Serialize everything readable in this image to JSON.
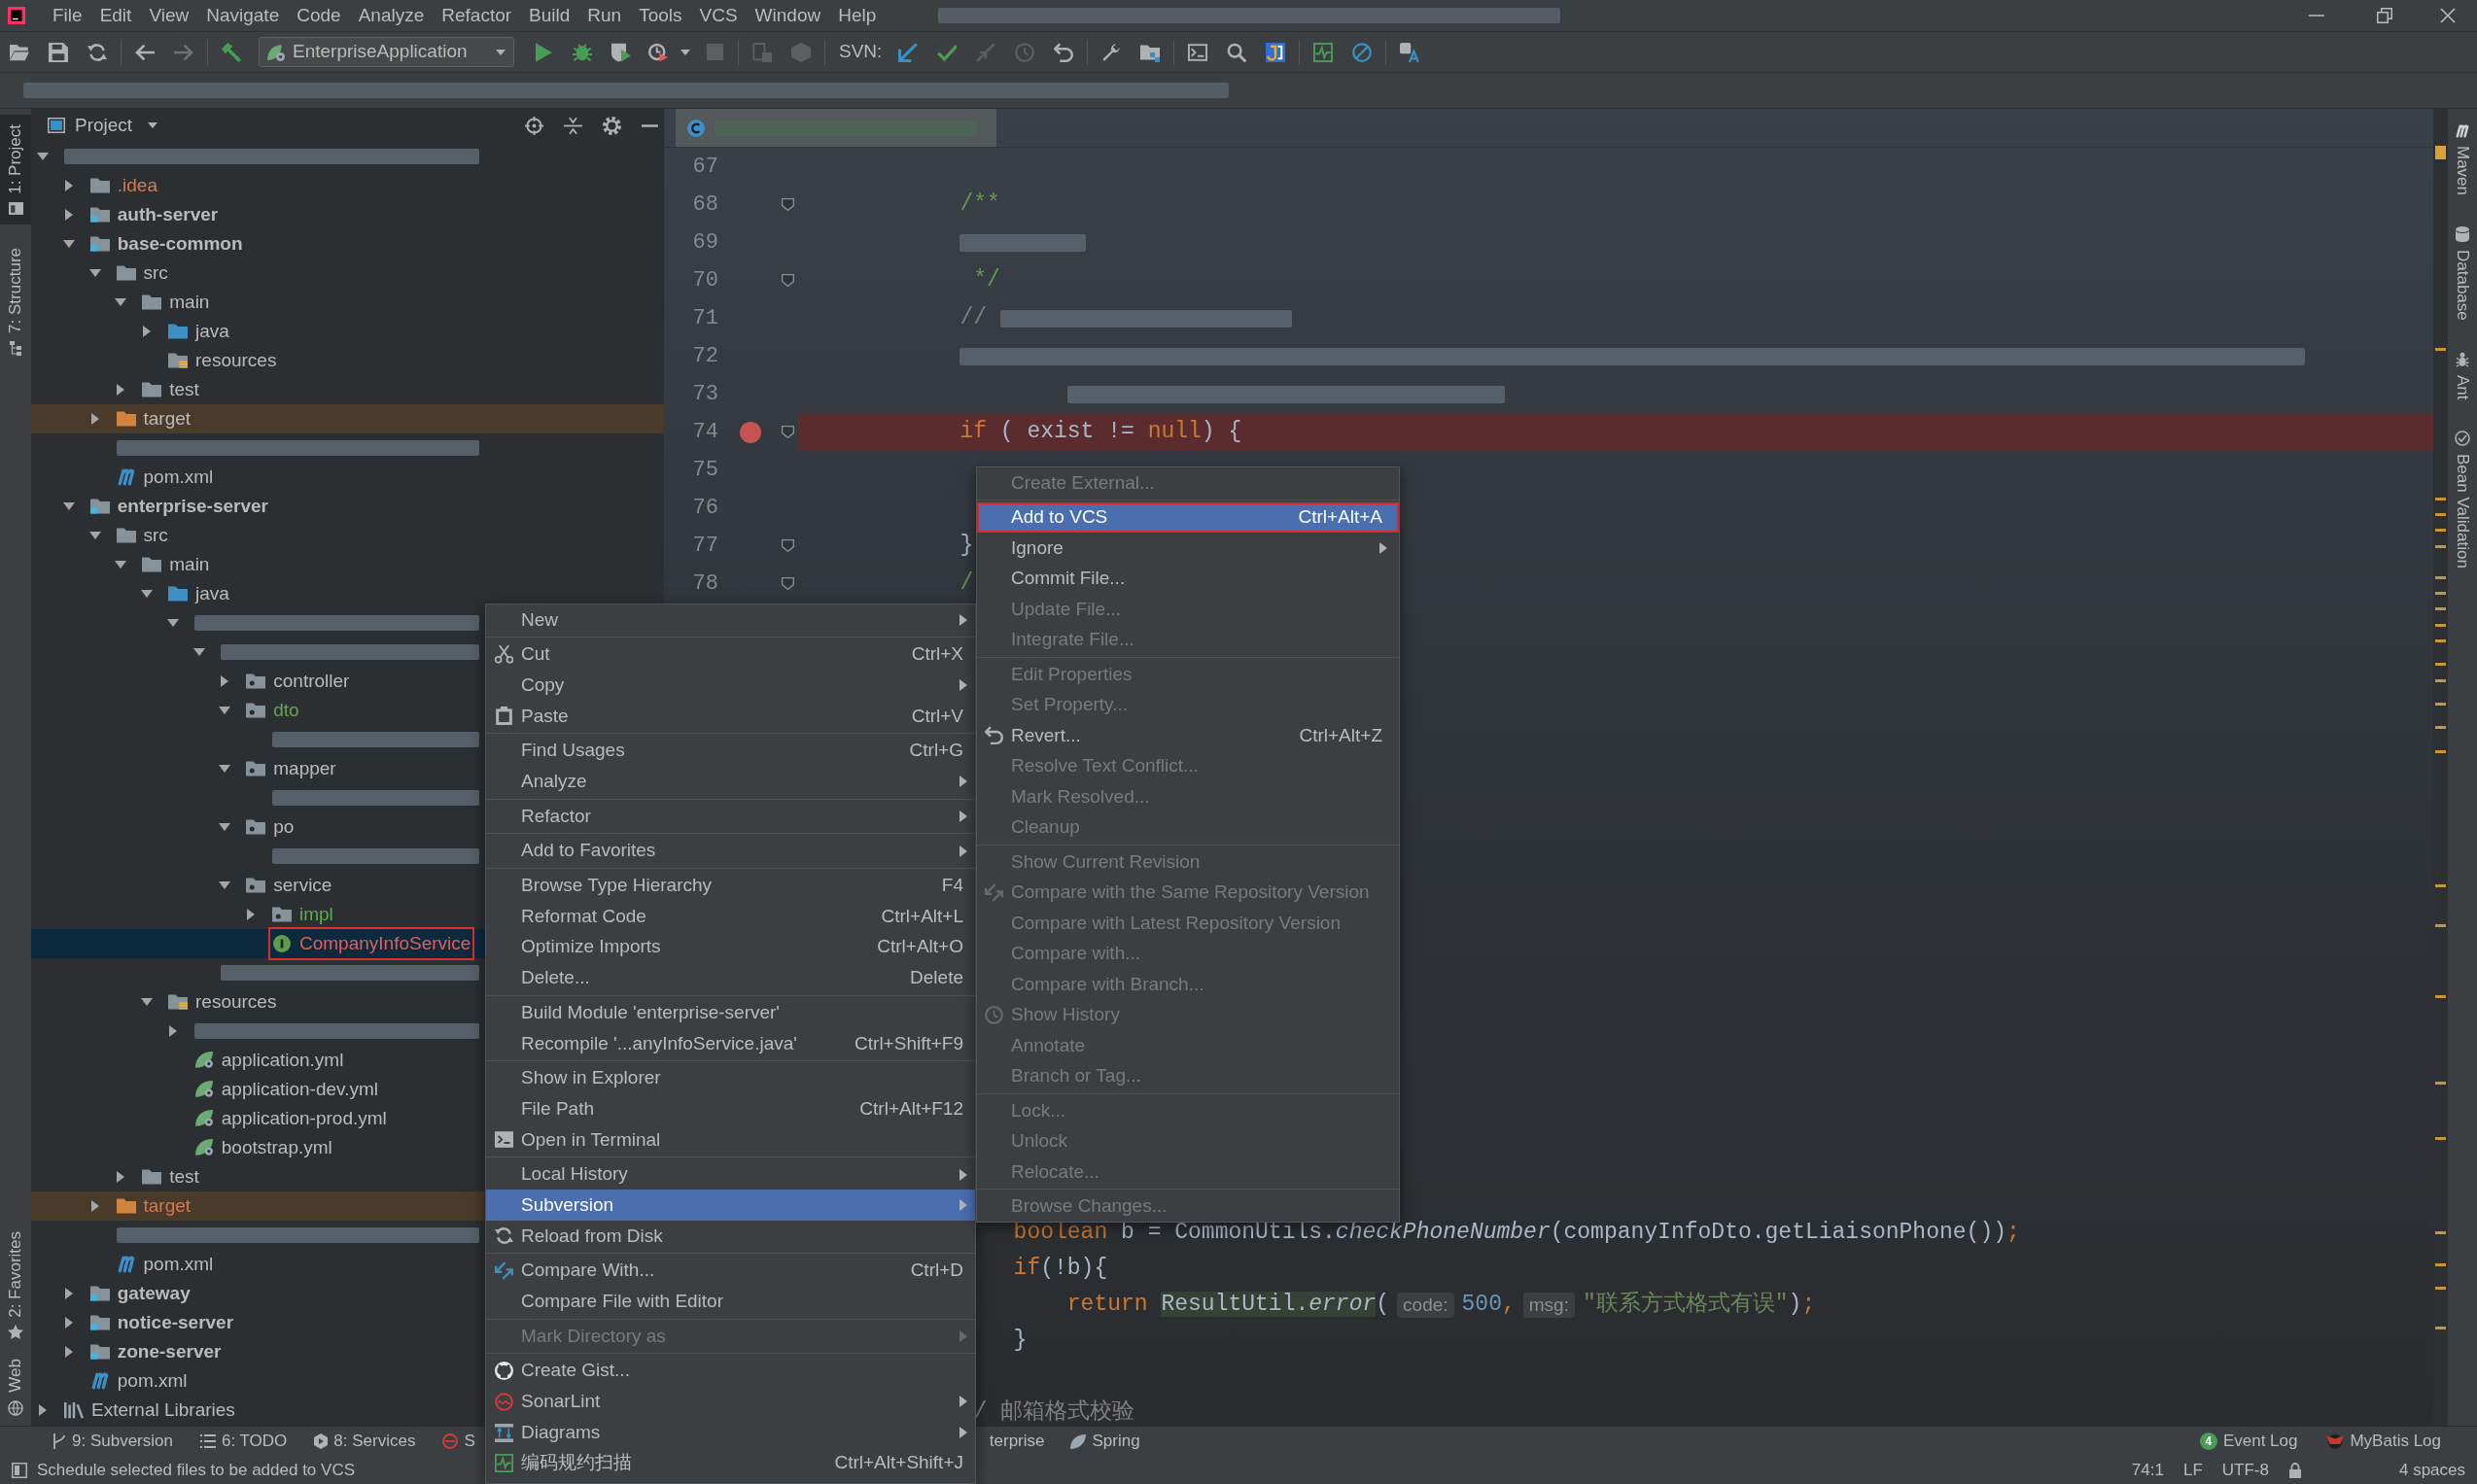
{
  "window_title": {
    "kind": "redacted"
  },
  "menu_bar": {
    "items": [
      "File",
      "Edit",
      "View",
      "Navigate",
      "Code",
      "Analyze",
      "Refactor",
      "Build",
      "Run",
      "Tools",
      "VCS",
      "Window",
      "Help"
    ]
  },
  "toolbar": {
    "run_configuration": "EnterpriseApplication",
    "svn_label": "SVN:"
  },
  "navigation_bar": {
    "kind": "redacted"
  },
  "left_strip": {
    "tabs": [
      {
        "label": "1: Project",
        "selected": true
      },
      {
        "label": "7: Structure",
        "selected": false
      },
      {
        "label": "2: Favorites",
        "selected": false
      },
      {
        "label": "Web",
        "selected": false
      }
    ]
  },
  "project_panel": {
    "title": "Project",
    "tree": [
      {
        "kind": "redacted",
        "expanded": true,
        "selected": false,
        "outlined": false,
        "children": [
          {
            "label": ".idea",
            "kind": "folder",
            "ignored": true,
            "added": false,
            "unversioned": false,
            "expanded": false,
            "selected": false,
            "outlined": false
          },
          {
            "label": "auth-server",
            "kind": "module",
            "ignored": false,
            "added": false,
            "unversioned": false,
            "expanded": false,
            "selected": false,
            "outlined": false
          },
          {
            "label": "base-common",
            "kind": "module",
            "ignored": false,
            "added": false,
            "unversioned": false,
            "expanded": true,
            "selected": false,
            "outlined": false,
            "children": [
              {
                "label": "src",
                "kind": "folder",
                "ignored": false,
                "added": false,
                "unversioned": false,
                "expanded": true,
                "selected": false,
                "outlined": false,
                "children": [
                  {
                    "label": "main",
                    "kind": "folder",
                    "ignored": false,
                    "added": false,
                    "unversioned": false,
                    "expanded": true,
                    "selected": false,
                    "outlined": false,
                    "children": [
                      {
                        "label": "java",
                        "kind": "source",
                        "ignored": false,
                        "added": false,
                        "unversioned": false,
                        "expanded": false,
                        "selected": false,
                        "outlined": false
                      },
                      {
                        "label": "resources",
                        "kind": "resources",
                        "ignored": false,
                        "added": false,
                        "unversioned": false,
                        "selected": false,
                        "outlined": false
                      }
                    ]
                  },
                  {
                    "label": "test",
                    "kind": "folder",
                    "ignored": false,
                    "added": false,
                    "unversioned": false,
                    "expanded": false,
                    "selected": false,
                    "outlined": false
                  }
                ]
              },
              {
                "label": "target",
                "kind": "excluded",
                "ignored": false,
                "added": false,
                "unversioned": false,
                "expanded": false,
                "selected": false,
                "outlined": false
              },
              {
                "kind": "redacted",
                "selected": false,
                "outlined": false
              },
              {
                "label": "pom.xml",
                "kind": "maven",
                "ignored": false,
                "added": false,
                "unversioned": false,
                "selected": false,
                "outlined": false
              }
            ]
          },
          {
            "label": "enterprise-server",
            "kind": "module",
            "ignored": false,
            "added": false,
            "unversioned": false,
            "expanded": true,
            "selected": false,
            "outlined": false,
            "children": [
              {
                "label": "src",
                "kind": "folder",
                "ignored": false,
                "added": false,
                "unversioned": false,
                "expanded": true,
                "selected": false,
                "outlined": false,
                "children": [
                  {
                    "label": "main",
                    "kind": "folder",
                    "ignored": false,
                    "added": false,
                    "unversioned": false,
                    "expanded": true,
                    "selected": false,
                    "outlined": false,
                    "children": [
                      {
                        "label": "java",
                        "kind": "source",
                        "ignored": false,
                        "added": false,
                        "unversioned": false,
                        "expanded": true,
                        "selected": false,
                        "outlined": false,
                        "children": [
                          {
                            "kind": "redacted",
                            "expanded": true,
                            "selected": false,
                            "outlined": false,
                            "children": [
                              {
                                "kind": "redacted",
                                "expanded": true,
                                "selected": false,
                                "outlined": false,
                                "children": [
                                  {
                                    "label": "controller",
                                    "kind": "package",
                                    "ignored": false,
                                    "added": false,
                                    "unversioned": false,
                                    "expanded": false,
                                    "selected": false,
                                    "outlined": false
                                  },
                                  {
                                    "label": "dto",
                                    "kind": "package",
                                    "ignored": false,
                                    "added": true,
                                    "unversioned": false,
                                    "expanded": true,
                                    "selected": false,
                                    "outlined": false,
                                    "children": [
                                      {
                                        "kind": "redacted",
                                        "selected": false,
                                        "outlined": false
                                      }
                                    ]
                                  },
                                  {
                                    "label": "mapper",
                                    "kind": "package",
                                    "ignored": false,
                                    "added": false,
                                    "unversioned": false,
                                    "expanded": true,
                                    "selected": false,
                                    "outlined": false,
                                    "children": [
                                      {
                                        "kind": "redacted",
                                        "selected": false,
                                        "outlined": false
                                      }
                                    ]
                                  },
                                  {
                                    "label": "po",
                                    "kind": "package",
                                    "ignored": false,
                                    "added": false,
                                    "unversioned": false,
                                    "expanded": true,
                                    "selected": false,
                                    "outlined": false,
                                    "children": [
                                      {
                                        "kind": "redacted",
                                        "selected": false,
                                        "outlined": false
                                      }
                                    ]
                                  },
                                  {
                                    "label": "service",
                                    "kind": "package",
                                    "ignored": false,
                                    "added": false,
                                    "unversioned": false,
                                    "expanded": true,
                                    "selected": false,
                                    "outlined": false,
                                    "children": [
                                      {
                                        "label": "impl",
                                        "kind": "package",
                                        "ignored": false,
                                        "added": true,
                                        "unversioned": false,
                                        "expanded": false,
                                        "selected": false,
                                        "outlined": false
                                      },
                                      {
                                        "label": "CompanyInfoService",
                                        "kind": "interface",
                                        "ignored": false,
                                        "added": false,
                                        "unversioned": true,
                                        "selected": true,
                                        "outlined": true
                                      }
                                    ]
                                  }
                                ]
                              },
                              {
                                "kind": "redacted",
                                "selected": false,
                                "outlined": false
                              }
                            ]
                          }
                        ]
                      },
                      {
                        "label": "resources",
                        "kind": "resources",
                        "ignored": false,
                        "added": false,
                        "unversioned": false,
                        "expanded": true,
                        "selected": false,
                        "outlined": false,
                        "children": [
                          {
                            "kind": "redacted",
                            "expanded": false,
                            "selected": false,
                            "outlined": false
                          },
                          {
                            "label": "application.yml",
                            "kind": "spring-config",
                            "ignored": false,
                            "added": false,
                            "unversioned": false,
                            "selected": false,
                            "outlined": false
                          },
                          {
                            "label": "application-dev.yml",
                            "kind": "spring-config",
                            "ignored": false,
                            "added": false,
                            "unversioned": false,
                            "selected": false,
                            "outlined": false
                          },
                          {
                            "label": "application-prod.yml",
                            "kind": "spring-config",
                            "ignored": false,
                            "added": false,
                            "unversioned": false,
                            "selected": false,
                            "outlined": false
                          },
                          {
                            "label": "bootstrap.yml",
                            "kind": "spring-config",
                            "ignored": false,
                            "added": false,
                            "unversioned": false,
                            "selected": false,
                            "outlined": false
                          }
                        ]
                      }
                    ]
                  },
                  {
                    "label": "test",
                    "kind": "folder",
                    "ignored": false,
                    "added": false,
                    "unversioned": false,
                    "expanded": false,
                    "selected": false,
                    "outlined": false
                  }
                ]
              },
              {
                "label": "target",
                "kind": "excluded",
                "ignored": true,
                "added": false,
                "unversioned": false,
                "expanded": false,
                "selected": false,
                "outlined": false
              },
              {
                "kind": "redacted",
                "selected": false,
                "outlined": false
              },
              {
                "label": "pom.xml",
                "kind": "maven",
                "ignored": false,
                "added": false,
                "unversioned": false,
                "selected": false,
                "outlined": false
              }
            ]
          },
          {
            "label": "gateway",
            "kind": "module",
            "ignored": false,
            "added": false,
            "unversioned": false,
            "expanded": false,
            "selected": false,
            "outlined": false
          },
          {
            "label": "notice-server",
            "kind": "module",
            "ignored": false,
            "added": false,
            "unversioned": false,
            "expanded": false,
            "selected": false,
            "outlined": false
          },
          {
            "label": "zone-server",
            "kind": "module",
            "ignored": false,
            "added": false,
            "unversioned": false,
            "expanded": false,
            "selected": false,
            "outlined": false
          },
          {
            "label": "pom.xml",
            "kind": "maven",
            "ignored": false,
            "added": false,
            "unversioned": false,
            "selected": false,
            "outlined": false
          }
        ]
      },
      {
        "label": "External Libraries",
        "kind": "libraries",
        "ignored": false,
        "added": false,
        "unversioned": false,
        "expanded": false,
        "selected": false,
        "outlined": false
      }
    ]
  },
  "editor": {
    "tabs": [
      {
        "kind": "redacted",
        "selected": true
      }
    ],
    "lines": [
      {
        "kind": "line",
        "number": "67",
        "breakpoint": false,
        "fold_marker": false
      },
      {
        "kind": "block",
        "children": [
          {
            "kind": "block",
            "children": [
              {
                "kind": "line",
                "number": "68",
                "breakpoint": false,
                "fold_marker": true,
                "segments": [
                  {
                    "kind": "code",
                    "tokens": [
                      {
                        "kind": "doc",
                        "text": "/**"
                      }
                    ]
                  }
                ]
              },
              {
                "kind": "line",
                "number": "69",
                "breakpoint": false,
                "fold_marker": false,
                "segments": [
                  {
                    "kind": "redacted-short"
                  }
                ]
              },
              {
                "kind": "line",
                "number": "70",
                "breakpoint": false,
                "fold_marker": true,
                "segments": [
                  {
                    "kind": "code",
                    "tokens": [
                      {
                        "kind": "doc",
                        "text": " */"
                      }
                    ]
                  }
                ]
              },
              {
                "kind": "line",
                "number": "71",
                "breakpoint": false,
                "fold_marker": false,
                "segments": [
                  {
                    "kind": "code",
                    "tokens": [
                      {
                        "kind": "comment",
                        "text": "//"
                      }
                    ]
                  },
                  {
                    "kind": "redacted-medium"
                  }
                ]
              },
              {
                "kind": "line",
                "number": "72",
                "breakpoint": false,
                "fold_marker": false,
                "segments": [
                  {
                    "kind": "redacted-full"
                  }
                ]
              },
              {
                "kind": "block",
                "children": [
                  {
                    "kind": "block",
                    "children": [
                      {
                        "kind": "line",
                        "number": "73",
                        "breakpoint": false,
                        "fold_marker": false,
                        "segments": [
                          {
                            "kind": "redacted-long"
                          }
                        ]
                      }
                    ]
                  }
                ]
              },
              {
                "kind": "line",
                "number": "74",
                "breakpoint": true,
                "fold_marker": true,
                "segments": [
                  {
                    "kind": "code",
                    "tokens": [
                      {
                        "kind": "keyword",
                        "text": "if"
                      },
                      {
                        "kind": "plain",
                        "text": " ( exist != "
                      },
                      {
                        "kind": "keyword",
                        "text": "null"
                      },
                      {
                        "kind": "plain",
                        "text": ") {"
                      }
                    ]
                  }
                ]
              },
              {
                "kind": "line",
                "number": "75",
                "breakpoint": false,
                "fold_marker": false
              },
              {
                "kind": "line",
                "number": "76",
                "breakpoint": false,
                "fold_marker": false
              },
              {
                "kind": "line",
                "number": "77",
                "breakpoint": false,
                "fold_marker": true,
                "segments": [
                  {
                    "kind": "code",
                    "tokens": [
                      {
                        "kind": "plain",
                        "text": "}"
                      }
                    ]
                  }
                ]
              },
              {
                "kind": "line",
                "number": "78",
                "breakpoint": false,
                "fold_marker": true,
                "segments": [
                  {
                    "kind": "code",
                    "tokens": [
                      {
                        "kind": "doc",
                        "text": "/"
                      }
                    ]
                  }
                ]
              }
            ]
          }
        ]
      }
    ],
    "lower_lines": [
      {
        "kind": "block",
        "children": [
          {
            "kind": "block",
            "children": [
              {
                "kind": "block",
                "children": [
                  {
                    "kind": "line",
                    "segments": [
                      {
                        "kind": "code",
                        "tokens": [
                          {
                            "kind": "keyword",
                            "text": "boolean"
                          },
                          {
                            "kind": "plain",
                            "text": " b = CommonUtils."
                          },
                          {
                            "kind": "italic",
                            "text": "checkPhoneNumber"
                          },
                          {
                            "kind": "plain",
                            "text": "(companyInfoDto.getLiaisonPhone())"
                          },
                          {
                            "kind": "keyword",
                            "text": ";"
                          }
                        ]
                      }
                    ]
                  },
                  {
                    "kind": "line",
                    "segments": [
                      {
                        "kind": "code",
                        "tokens": [
                          {
                            "kind": "keyword",
                            "text": "if"
                          },
                          {
                            "kind": "plain",
                            "text": "(!b){"
                          }
                        ]
                      }
                    ]
                  },
                  {
                    "kind": "block",
                    "children": [
                      {
                        "kind": "line",
                        "segments": [
                          {
                            "kind": "code",
                            "tokens": [
                              {
                                "kind": "keyword",
                                "text": "return "
                              },
                              {
                                "kind": "highlight",
                                "text": "ResultUtil."
                              },
                              {
                                "kind": "highlight-italic",
                                "text": "error"
                              },
                              {
                                "kind": "plain",
                                "text": "("
                              }
                            ]
                          },
                          {
                            "kind": "hint",
                            "text": "code:"
                          },
                          {
                            "kind": "code",
                            "tokens": [
                              {
                                "kind": "number",
                                "text": "500"
                              },
                              {
                                "kind": "keyword",
                                "text": ","
                              }
                            ]
                          },
                          {
                            "kind": "hint",
                            "text": "msg:"
                          },
                          {
                            "kind": "code",
                            "tokens": [
                              {
                                "kind": "string",
                                "text": "\"联系方式格式有误\""
                              },
                              {
                                "kind": "plain",
                                "text": ")"
                              },
                              {
                                "kind": "keyword",
                                "text": ";"
                              }
                            ]
                          }
                        ]
                      }
                    ]
                  },
                  {
                    "kind": "line",
                    "segments": [
                      {
                        "kind": "code",
                        "tokens": [
                          {
                            "kind": "plain",
                            "text": "}"
                          }
                        ]
                      }
                    ]
                  }
                ]
              },
              {
                "kind": "line"
              },
              {
                "kind": "line",
                "segments": [
                  {
                    "kind": "code-clipped",
                    "tokens": [
                      {
                        "kind": "comment",
                        "text": "/ 邮箱格式校验"
                      }
                    ]
                  }
                ]
              }
            ]
          }
        ]
      }
    ]
  },
  "right_strip": {
    "tabs": [
      {
        "label": "Maven",
        "selected": false
      },
      {
        "label": "Database",
        "selected": false
      },
      {
        "label": "Ant",
        "selected": false
      },
      {
        "label": "Bean Validation",
        "selected": false
      }
    ]
  },
  "context_menu": {
    "groups": [
      [
        {
          "label": "New",
          "submenu": true,
          "disabled": false,
          "selected": false
        }
      ],
      [
        {
          "label": "Cut",
          "shortcut": "Ctrl+X",
          "submenu": false,
          "disabled": false,
          "selected": false
        },
        {
          "label": "Copy",
          "submenu": true,
          "disabled": false,
          "selected": false
        },
        {
          "label": "Paste",
          "shortcut": "Ctrl+V",
          "submenu": false,
          "disabled": false,
          "selected": false
        }
      ],
      [
        {
          "label": "Find Usages",
          "shortcut": "Ctrl+G",
          "submenu": false,
          "disabled": false,
          "selected": false
        },
        {
          "label": "Analyze",
          "submenu": true,
          "disabled": false,
          "selected": false
        }
      ],
      [
        {
          "label": "Refactor",
          "submenu": true,
          "disabled": false,
          "selected": false
        }
      ],
      [
        {
          "label": "Add to Favorites",
          "submenu": true,
          "disabled": false,
          "selected": false
        }
      ],
      [
        {
          "label": "Browse Type Hierarchy",
          "shortcut": "F4",
          "submenu": false,
          "disabled": false,
          "selected": false
        },
        {
          "label": "Reformat Code",
          "shortcut": "Ctrl+Alt+L",
          "submenu": false,
          "disabled": false,
          "selected": false
        },
        {
          "label": "Optimize Imports",
          "shortcut": "Ctrl+Alt+O",
          "submenu": false,
          "disabled": false,
          "selected": false
        },
        {
          "label": "Delete...",
          "shortcut": "Delete",
          "submenu": false,
          "disabled": false,
          "selected": false
        }
      ],
      [
        {
          "label": "Build Module 'enterprise-server'",
          "submenu": false,
          "disabled": false,
          "selected": false
        },
        {
          "label": "Recompile '...anyInfoService.java'",
          "shortcut": "Ctrl+Shift+F9",
          "submenu": false,
          "disabled": false,
          "selected": false
        }
      ],
      [
        {
          "label": "Show in Explorer",
          "submenu": false,
          "disabled": false,
          "selected": false
        },
        {
          "label": "File Path",
          "shortcut": "Ctrl+Alt+F12",
          "submenu": false,
          "disabled": false,
          "selected": false
        },
        {
          "label": "Open in Terminal",
          "submenu": false,
          "disabled": false,
          "selected": false
        }
      ],
      [
        {
          "label": "Local History",
          "submenu": true,
          "disabled": false,
          "selected": false
        },
        {
          "label": "Subversion",
          "submenu": true,
          "disabled": false,
          "selected": true
        },
        {
          "label": "Reload from Disk",
          "submenu": false,
          "disabled": false,
          "selected": false
        }
      ],
      [
        {
          "label": "Compare With...",
          "shortcut": "Ctrl+D",
          "submenu": false,
          "disabled": false,
          "selected": false
        },
        {
          "label": "Compare File with Editor",
          "submenu": false,
          "disabled": false,
          "selected": false
        }
      ],
      [
        {
          "label": "Mark Directory as",
          "submenu": true,
          "disabled": true,
          "selected": false
        }
      ],
      [
        {
          "label": "Create Gist...",
          "submenu": false,
          "disabled": false,
          "selected": false
        },
        {
          "label": "SonarLint",
          "submenu": true,
          "disabled": false,
          "selected": false
        },
        {
          "label": "Diagrams",
          "submenu": true,
          "disabled": false,
          "selected": false
        },
        {
          "label": "编码规约扫描",
          "shortcut": "Ctrl+Alt+Shift+J",
          "submenu": false,
          "disabled": false,
          "selected": false
        }
      ]
    ]
  },
  "submenu": {
    "groups": [
      [
        {
          "label": "Create External...",
          "submenu": false,
          "disabled": true,
          "selected": false,
          "outlined": false
        }
      ],
      [
        {
          "label": "Add to VCS",
          "shortcut": "Ctrl+Alt+A",
          "submenu": false,
          "disabled": false,
          "selected": true,
          "outlined": true
        },
        {
          "label": "Ignore",
          "submenu": true,
          "disabled": false,
          "selected": false,
          "outlined": false
        },
        {
          "label": "Commit File...",
          "submenu": false,
          "disabled": false,
          "selected": false,
          "outlined": false
        },
        {
          "label": "Update File...",
          "submenu": false,
          "disabled": true,
          "selected": false,
          "outlined": false
        },
        {
          "label": "Integrate File...",
          "submenu": false,
          "disabled": true,
          "selected": false,
          "outlined": false
        }
      ],
      [
        {
          "label": "Edit Properties",
          "submenu": false,
          "disabled": true,
          "selected": false,
          "outlined": false
        },
        {
          "label": "Set Property...",
          "submenu": false,
          "disabled": true,
          "selected": false,
          "outlined": false
        },
        {
          "label": "Revert...",
          "shortcut": "Ctrl+Alt+Z",
          "submenu": false,
          "disabled": false,
          "selected": false,
          "outlined": false
        },
        {
          "label": "Resolve Text Conflict...",
          "submenu": false,
          "disabled": true,
          "selected": false,
          "outlined": false
        },
        {
          "label": "Mark Resolved...",
          "submenu": false,
          "disabled": true,
          "selected": false,
          "outlined": false
        },
        {
          "label": "Cleanup",
          "submenu": false,
          "disabled": true,
          "selected": false,
          "outlined": false
        }
      ],
      [
        {
          "label": "Show Current Revision",
          "submenu": false,
          "disabled": true,
          "selected": false,
          "outlined": false
        },
        {
          "label": "Compare with the Same Repository Version",
          "submenu": false,
          "disabled": true,
          "selected": false,
          "outlined": false
        },
        {
          "label": "Compare with Latest Repository Version",
          "submenu": false,
          "disabled": true,
          "selected": false,
          "outlined": false
        },
        {
          "label": "Compare with...",
          "submenu": false,
          "disabled": true,
          "selected": false,
          "outlined": false
        },
        {
          "label": "Compare with Branch...",
          "submenu": false,
          "disabled": true,
          "selected": false,
          "outlined": false
        },
        {
          "label": "Show History",
          "submenu": false,
          "disabled": true,
          "selected": false,
          "outlined": false
        },
        {
          "label": "Annotate",
          "submenu": false,
          "disabled": true,
          "selected": false,
          "outlined": false
        },
        {
          "label": "Branch or Tag...",
          "submenu": false,
          "disabled": true,
          "selected": false,
          "outlined": false
        }
      ],
      [
        {
          "label": "Lock...",
          "submenu": false,
          "disabled": true,
          "selected": false,
          "outlined": false
        },
        {
          "label": "Unlock",
          "submenu": false,
          "disabled": true,
          "selected": false,
          "outlined": false
        },
        {
          "label": "Relocate...",
          "submenu": false,
          "disabled": true,
          "selected": false,
          "outlined": false
        }
      ],
      [
        {
          "label": "Browse Changes...",
          "submenu": false,
          "disabled": true,
          "selected": false,
          "outlined": false
        }
      ]
    ]
  },
  "tool_window_bar": {
    "left": [
      {
        "label": "9: Subversion"
      },
      {
        "label": "6: TODO"
      },
      {
        "label": "8: Services"
      },
      {
        "label": "S"
      }
    ],
    "middle": [
      {
        "label": "terprise"
      },
      {
        "label": "Spring"
      }
    ],
    "right": [
      {
        "label": "Event Log",
        "badge": "4"
      },
      {
        "label": "MyBatis Log"
      }
    ]
  },
  "status_bar": {
    "message": "Schedule selected files to be added to VCS",
    "caret_position": "74:1",
    "line_separator": "LF",
    "encoding": "UTF-8",
    "indentation": "4 spaces"
  }
}
